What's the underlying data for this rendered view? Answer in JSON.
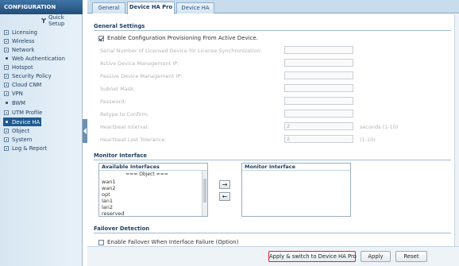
{
  "sidebar": {
    "title": "CONFIGURATION",
    "quick_setup": "Quick Setup",
    "items": [
      {
        "label": "Licensing",
        "marker": "box"
      },
      {
        "label": "Wireless",
        "marker": "box"
      },
      {
        "label": "Network",
        "marker": "box"
      },
      {
        "label": "Web Authentication",
        "marker": "dot"
      },
      {
        "label": "Hotspot",
        "marker": "box"
      },
      {
        "label": "Security Policy",
        "marker": "box"
      },
      {
        "label": "Cloud CNM",
        "marker": "box"
      },
      {
        "label": "VPN",
        "marker": "box"
      },
      {
        "label": "BWM",
        "marker": "dot"
      },
      {
        "label": "UTM Profile",
        "marker": "box"
      },
      {
        "label": "Device HA",
        "marker": "dot",
        "active": true
      },
      {
        "label": "Object",
        "marker": "box"
      },
      {
        "label": "System",
        "marker": "box"
      },
      {
        "label": "Log & Report",
        "marker": "box"
      }
    ]
  },
  "tabs": [
    {
      "label": "General"
    },
    {
      "label": "Device HA Pro",
      "active": true
    },
    {
      "label": "Device HA"
    }
  ],
  "general_settings": {
    "title": "General Settings",
    "enable_label": "Enable Configuration Provisioning From Active Device.",
    "enable_checked": true,
    "fields": [
      {
        "label": "Serial Number of Licensed Device for License Synchronization:",
        "value": ""
      },
      {
        "label": "Active Device Management IP:",
        "value": ""
      },
      {
        "label": "Passive Device Management IP:",
        "value": ""
      },
      {
        "label": "Subnet Mask:",
        "value": ""
      },
      {
        "label": "Password:",
        "value": ""
      },
      {
        "label": "Retype to Confirm:",
        "value": ""
      },
      {
        "label": "Heartbeat Interval:",
        "value": "2",
        "hint": "seconds (1-10)"
      },
      {
        "label": "Heartbeat Lost Tolerance:",
        "value": "2",
        "hint": "(1-10)"
      }
    ]
  },
  "monitor_interface": {
    "title": "Monitor Interface",
    "available_header": "Available Interfaces",
    "group_label": "=== Object ===",
    "available_items": [
      "wan1",
      "wan2",
      "opt",
      "lan1",
      "lan2",
      "reserved"
    ],
    "selected_header": "Monitor Interface",
    "add_arrow": "→",
    "remove_arrow": "←"
  },
  "failover_detection": {
    "title": "Failover Detection",
    "checkbox_label": "Enable Failover When Interface Failure (Option)"
  },
  "buttons": {
    "apply_switch": "Apply & switch to Device HA Pro",
    "apply": "Apply",
    "reset": "Reset"
  },
  "colors": {
    "highlight_border": "#d9232a",
    "active_nav": "#1e5a91"
  }
}
